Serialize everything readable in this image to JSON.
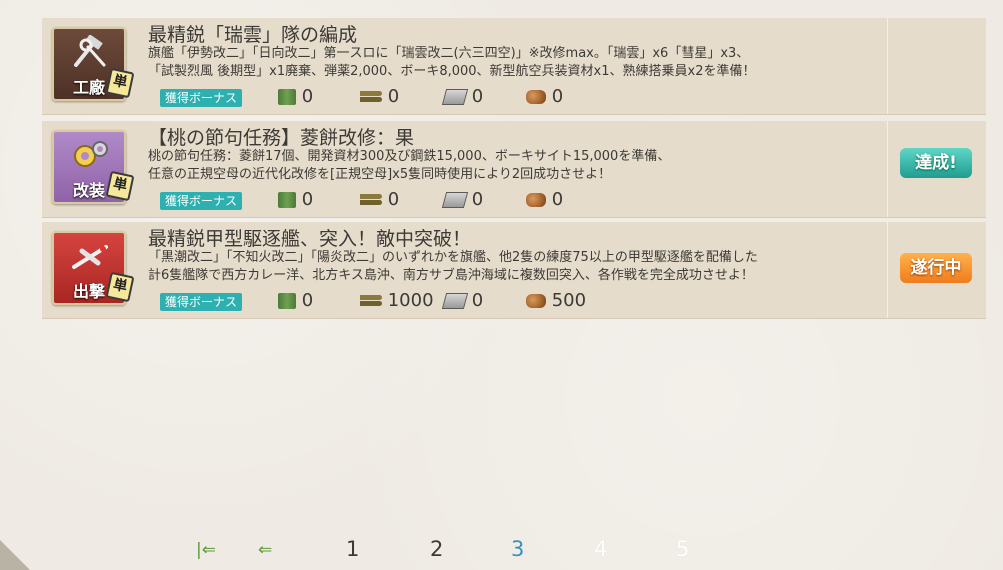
{
  "quests": [
    {
      "category_label": "工廠",
      "category_icon": "hammer-wrench-icon",
      "type_badge": "単",
      "title": "最精鋭「瑞雲」隊の編成",
      "desc_line1": "旗艦「伊勢改二」「日向改二」第一スロに「瑞雲改二(六三四空)」※改修max。「瑞雲」x6「彗星」x3、",
      "desc_line2": "「試製烈風 後期型」x1廃棄、弾薬2,000、ボーキ8,000、新型航空兵装資材x1、熟練搭乗員x2を準備！",
      "bonus_label": "獲得ボーナス",
      "rewards": {
        "fuel": "0",
        "ammo": "0",
        "steel": "0",
        "bauxite": "0"
      },
      "status": ""
    },
    {
      "category_label": "改装",
      "category_icon": "gears-icon",
      "type_badge": "単",
      "title": "【桃の節句任務】菱餅改修：果",
      "desc_line1": "桃の節句任務：菱餅17個、開発資材300及び鋼鉄15,000、ボーキサイト15,000を準備、",
      "desc_line2": "任意の正規空母の近代化改修を[正規空母]x5隻同時使用により2回成功させよ！",
      "bonus_label": "獲得ボーナス",
      "rewards": {
        "fuel": "0",
        "ammo": "0",
        "steel": "0",
        "bauxite": "0"
      },
      "status": "達成!"
    },
    {
      "category_label": "出撃",
      "category_icon": "plane-icon",
      "type_badge": "単",
      "title": "最精鋭甲型駆逐艦、突入！敵中突破！",
      "desc_line1": "「黒潮改二」「不知火改二」「陽炎改二」のいずれかを旗艦、他2隻の練度75以上の甲型駆逐艦を配備した",
      "desc_line2": "計6隻艦隊で西方カレー洋、北方キス島沖、南方サブ島沖海域に複数回突入、各作戦を完全成功させよ！",
      "bonus_label": "獲得ボーナス",
      "rewards": {
        "fuel": "0",
        "ammo": "1000",
        "steel": "0",
        "bauxite": "500"
      },
      "status": "遂行中"
    }
  ],
  "pager": {
    "first_icon": "first-page-icon",
    "prev_icon": "prev-page-icon",
    "pages": [
      "1",
      "2",
      "3",
      "4",
      "5"
    ],
    "current": "3"
  }
}
